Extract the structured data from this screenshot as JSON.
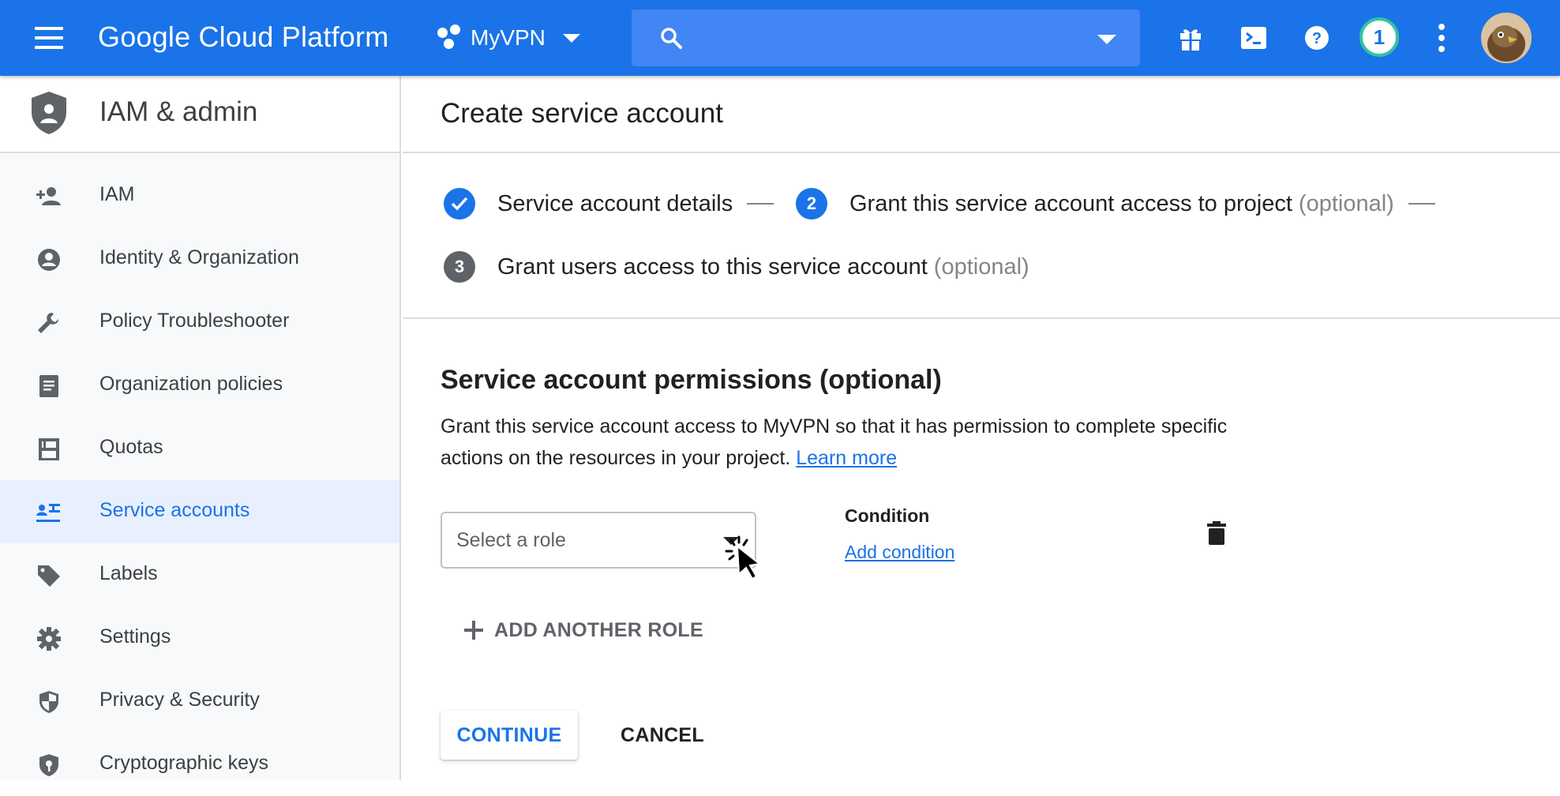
{
  "topbar": {
    "brand": "Google Cloud Platform",
    "project": "MyVPN",
    "notification_count": "1",
    "icons": [
      "menu-icon",
      "project-icon",
      "search-icon",
      "gift-icon",
      "cloud-shell-icon",
      "help-icon",
      "more-vert-icon",
      "avatar"
    ]
  },
  "sidebar": {
    "title": "IAM & admin",
    "items": [
      {
        "label": "IAM",
        "icon": "person-add-icon"
      },
      {
        "label": "Identity & Organization",
        "icon": "account-circle-icon"
      },
      {
        "label": "Policy Troubleshooter",
        "icon": "wrench-icon"
      },
      {
        "label": "Organization policies",
        "icon": "document-icon"
      },
      {
        "label": "Quotas",
        "icon": "quota-icon"
      },
      {
        "label": "Service accounts",
        "icon": "service-account-icon",
        "active": true
      },
      {
        "label": "Labels",
        "icon": "label-icon"
      },
      {
        "label": "Settings",
        "icon": "gear-icon"
      },
      {
        "label": "Privacy & Security",
        "icon": "security-shield-icon"
      },
      {
        "label": "Cryptographic keys",
        "icon": "key-shield-icon"
      }
    ]
  },
  "main": {
    "title": "Create service account",
    "steps": [
      {
        "label": "Service account details",
        "optional": "",
        "state": "done"
      },
      {
        "label": "Grant this service account access to project",
        "optional": "(optional)",
        "number": "2",
        "state": "current"
      },
      {
        "label": "Grant users access to this service account",
        "optional": "(optional)",
        "number": "3",
        "state": "pending"
      }
    ],
    "permissions_title": "Service account permissions (optional)",
    "permissions_desc": "Grant this service account access to MyVPN so that it has permission to complete specific actions on the resources in your project.",
    "learn_more": "Learn more",
    "role_placeholder": "Select a role",
    "condition_label": "Condition",
    "add_condition": "Add condition",
    "add_another_role": "ADD ANOTHER ROLE",
    "continue": "CONTINUE",
    "cancel": "CANCEL"
  },
  "colors": {
    "topbar": "#1a73e8",
    "search": "#4285f4",
    "accent": "#1a73e8",
    "active_bg": "#e8f0fe",
    "step_pending": "#5f6368"
  }
}
